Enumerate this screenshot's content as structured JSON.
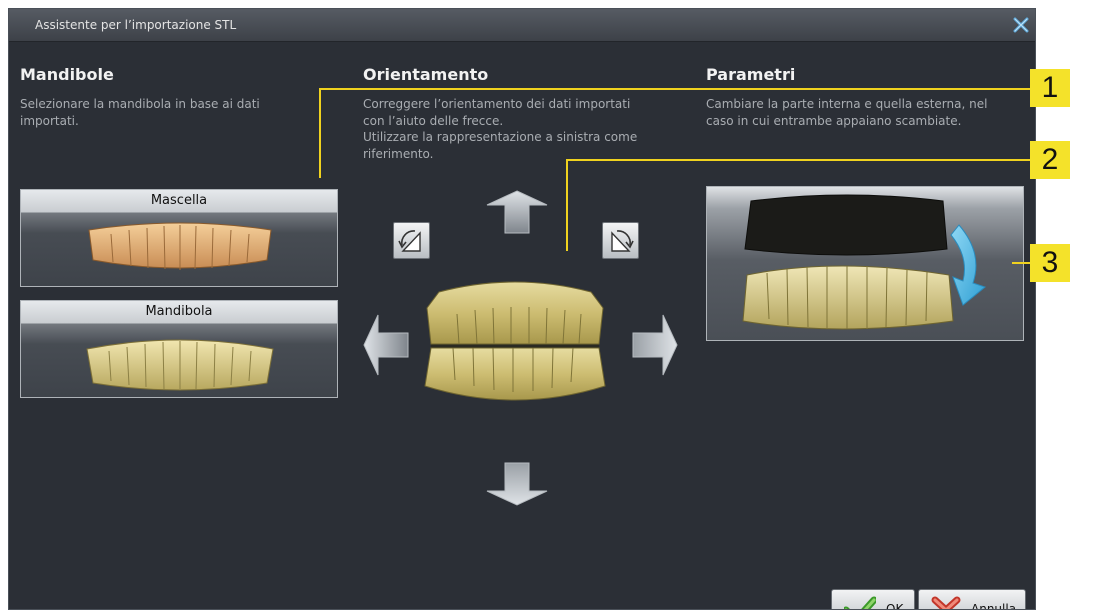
{
  "dialog": {
    "title": "Assistente per l’importazione STL"
  },
  "sections": {
    "jaws": {
      "heading": "Mandibole",
      "desc_line1": "Selezionare la mandibola in base ai dati",
      "desc_line2": "importati.",
      "maxilla_label": "Mascella",
      "mandible_label": "Mandibola"
    },
    "orientation": {
      "heading": "Orientamento",
      "desc_line1": "Correggere l’orientamento dei dati importati",
      "desc_line2": "con l’aiuto delle frecce.",
      "desc_line3": "Utilizzare la rappresentazione a sinistra come",
      "desc_line4": "riferimento."
    },
    "parameters": {
      "heading": "Parametri",
      "desc_line1": "Cambiare la parte interna e quella esterna, nel",
      "desc_line2": "caso in cui entrambe appaiano scambiate."
    }
  },
  "footer": {
    "ok_label": "OK",
    "cancel_label": "Annulla"
  },
  "callouts": [
    "1",
    "2",
    "3"
  ],
  "icons": {
    "close": "close-x-icon",
    "rotate_ccw": "rotate-left-icon",
    "rotate_cw": "rotate-right-icon",
    "ok": "green-check-icon",
    "cancel": "red-x-icon",
    "swap": "swap-arrow-icon"
  },
  "colors": {
    "background": "#2b2f36",
    "heading": "#f2f2f2",
    "description": "#a9adb2",
    "model_upper": "#e8b77f",
    "model_lower": "#d8cc8c",
    "callout": "#f4e22a",
    "swap_arrow": "#4fb9e6"
  }
}
